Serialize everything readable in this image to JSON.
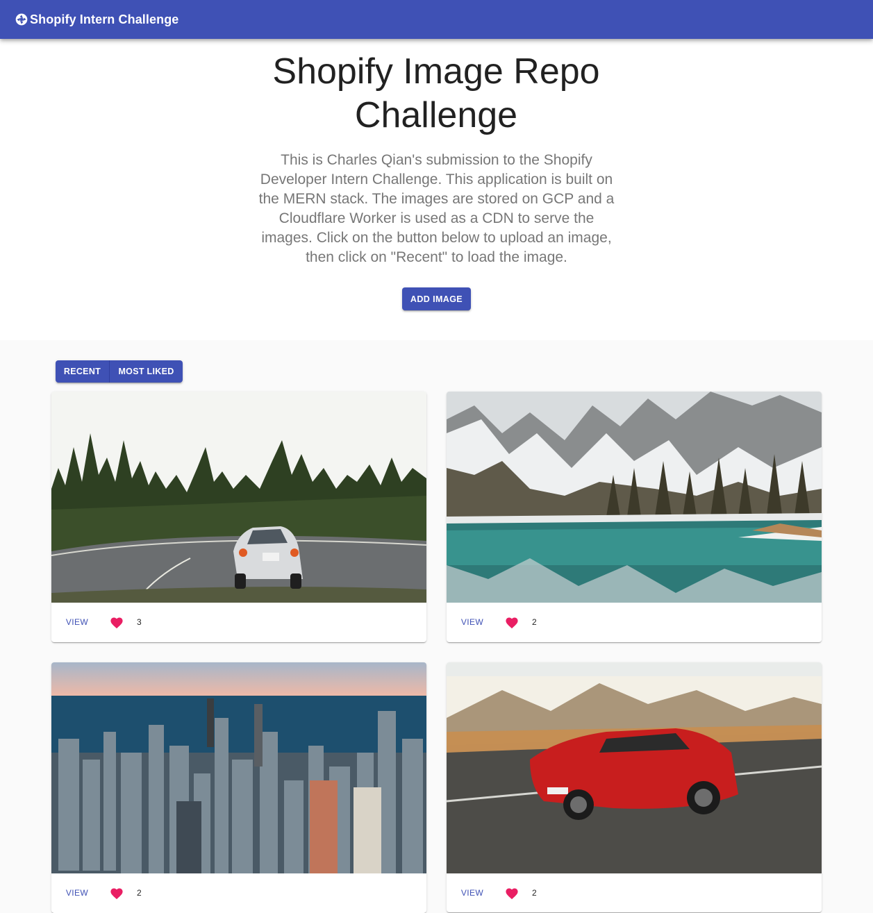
{
  "app": {
    "brand": "Shopify Intern Challenge",
    "accent": "#3f51b5",
    "like_color": "#e91e63"
  },
  "hero": {
    "title": "Shopify Image Repo Challenge",
    "description": "This is Charles Qian's submission to the Shopify Developer Intern Challenge. This application is built on the MERN stack. The images are stored on GCP and a Cloudflare Worker is used as a CDN to serve the images. Click on the button below to upload an image, then click on \"Recent\" to load the image.",
    "add_button": "ADD IMAGE"
  },
  "sort": {
    "recent": "RECENT",
    "most_liked": "MOST LIKED"
  },
  "cards": [
    {
      "subject": "white sports car on mountain road with forest",
      "view": "VIEW",
      "likes": "3"
    },
    {
      "subject": "snowy mountains reflected in turquoise lake",
      "view": "VIEW",
      "likes": "2"
    },
    {
      "subject": "aerial city skyline by the lake at sunset",
      "view": "VIEW",
      "likes": "2"
    },
    {
      "subject": "red sports car driving on highway at sunset",
      "view": "VIEW",
      "likes": "2"
    }
  ]
}
